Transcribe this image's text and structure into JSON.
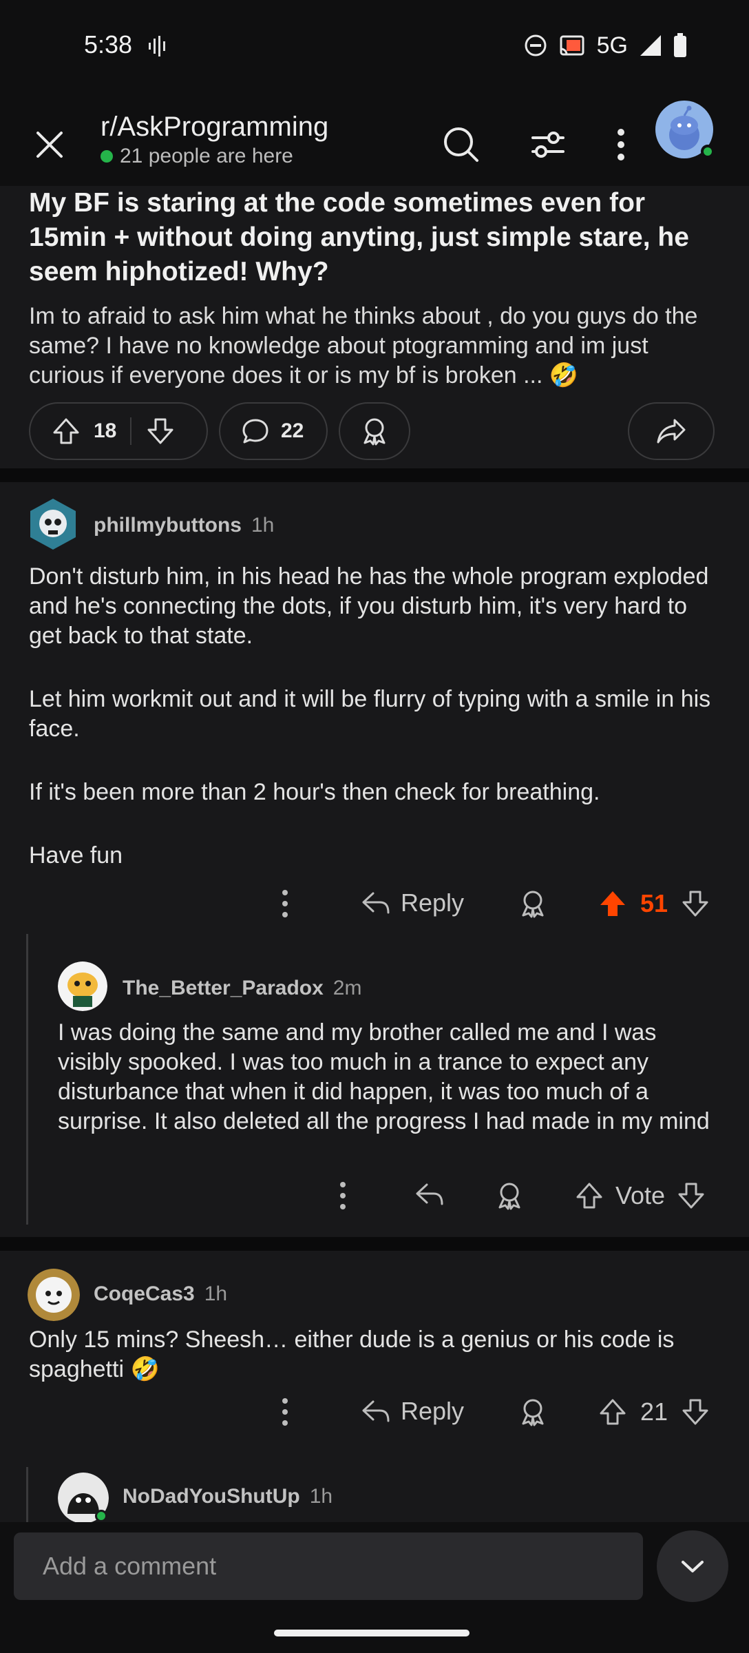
{
  "status_bar": {
    "time": "5:38",
    "network": "5G"
  },
  "header": {
    "subreddit": "r/AskProgramming",
    "online": "21 people are here"
  },
  "post": {
    "title": "My BF is staring at the code sometimes even for 15min + without doing anyting, just simple stare, he seem hiphotized! Why?",
    "body": "Im to afraid to ask him what he thinks about , do you guys do the same? I have no knowledge about ptogramming and im just curious if everyone does it or is my bf is broken ... 🤣",
    "upvotes": "18",
    "comments": "22"
  },
  "comments": [
    {
      "author": "phillmybuttons",
      "time": "1h",
      "paragraphs": [
        "Don't disturb him, in his head he has the whole program exploded and he's connecting the dots, if you disturb him, it's very hard to get back to that state.",
        "Let him workmit out and it will be flurry of typing with a smile in his face.",
        "If it's been more than 2 hour's then check for breathing.",
        "Have fun"
      ],
      "reply_label": "Reply",
      "score": "51",
      "score_color": "#ff4500"
    },
    {
      "author": "The_Better_Paradox",
      "time": "2m",
      "text": "I was doing the same and my brother called me and I was visibly spooked. I was too much in a trance to expect any disturbance that when it did happen, it was too much of a surprise. It also deleted all the progress I had made in my mind",
      "vote_label": "Vote"
    },
    {
      "author": "CoqeCas3",
      "time": "1h",
      "text": "Only 15 mins? Sheesh… either dude is a genius or his code is spaghetti 🤣",
      "reply_label": "Reply",
      "score": "21"
    },
    {
      "author": "NoDadYouShutUp",
      "time": "1h"
    }
  ],
  "composer": {
    "placeholder": "Add a comment"
  },
  "colors": {
    "accent": "#ff4500",
    "online": "#25b44a",
    "background": "#18181a"
  }
}
